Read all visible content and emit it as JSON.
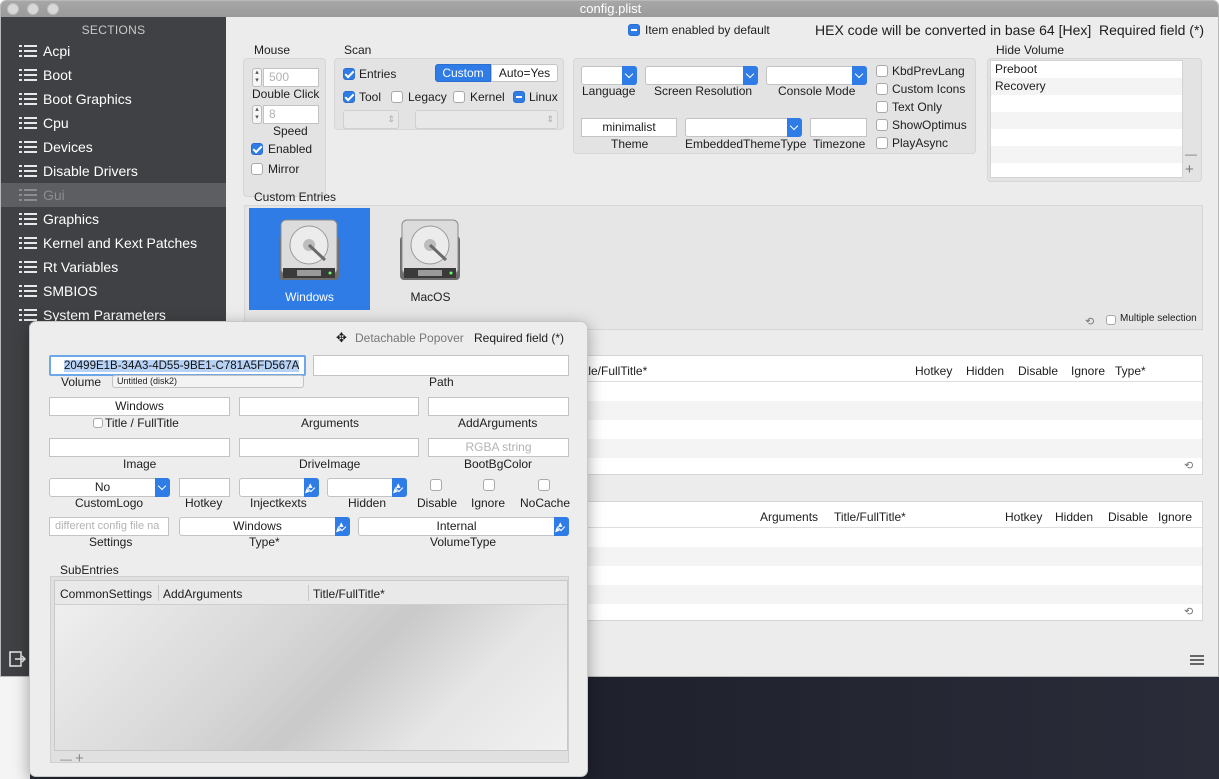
{
  "window": {
    "title": "config.plist"
  },
  "sidebar": {
    "header": "SECTIONS",
    "items": [
      {
        "label": "Acpi"
      },
      {
        "label": "Boot"
      },
      {
        "label": "Boot Graphics"
      },
      {
        "label": "Cpu"
      },
      {
        "label": "Devices"
      },
      {
        "label": "Disable Drivers"
      },
      {
        "label": "Gui",
        "selected": true
      },
      {
        "label": "Graphics"
      },
      {
        "label": "Kernel and Kext Patches"
      },
      {
        "label": "Rt Variables"
      },
      {
        "label": "SMBIOS"
      },
      {
        "label": "System Parameters"
      }
    ]
  },
  "topbar": {
    "item_enabled_label": "Item enabled by default",
    "hex_note": "HEX code will be converted in base 64 [Hex]",
    "required_note": "Required field (*)"
  },
  "mouse": {
    "title": "Mouse",
    "double_click_value": "500",
    "double_click_label": "Double Click",
    "speed_value": "8",
    "speed_label": "Speed",
    "enabled_label": "Enabled",
    "enabled": true,
    "mirror_label": "Mirror",
    "mirror": false
  },
  "scan": {
    "title": "Scan",
    "entries_label": "Entries",
    "entries": true,
    "custom_label": "Custom",
    "autoyes_label": "Auto=Yes",
    "tool_label": "Tool",
    "tool": true,
    "legacy_label": "Legacy",
    "kernel_label": "Kernel",
    "linux_label": "Linux"
  },
  "gui_fields": {
    "language_label": "Language",
    "resolution_label": "Screen Resolution",
    "console_label": "Console Mode",
    "theme_value": "minimalist",
    "theme_label": "Theme",
    "embedded_theme_label": "EmbeddedThemeType",
    "timezone_label": "Timezone",
    "checks": [
      {
        "label": "KbdPrevLang"
      },
      {
        "label": "Custom Icons"
      },
      {
        "label": "Text Only"
      },
      {
        "label": "ShowOptimus"
      },
      {
        "label": "PlayAsync"
      }
    ]
  },
  "hide_volume": {
    "title": "Hide Volume",
    "items": [
      "Preboot",
      "Recovery"
    ],
    "minus": "—",
    "plus": "+"
  },
  "custom_entries": {
    "title": "Custom Entries",
    "entries": [
      {
        "label": "Windows",
        "selected": true
      },
      {
        "label": "MacOS",
        "selected": false
      }
    ],
    "multiple_selection_label": "Multiple selection",
    "minus": "—",
    "plus": "+"
  },
  "table1": {
    "columns": [
      "tle/FullTitle*",
      "Hotkey",
      "Hidden",
      "Disable",
      "Ignore",
      "Type*"
    ]
  },
  "table2": {
    "columns": [
      "Arguments",
      "Title/FullTitle*",
      "Hotkey",
      "Hidden",
      "Disable",
      "Ignore"
    ]
  },
  "popover": {
    "detach_label": "Detachable Popover",
    "required_label": "Required field (*)",
    "uuid_value": "20499E1B-34A3-4D55-9BE1-C781A5FD567A",
    "volume_label": "Volume",
    "volume_value": "Untitled (disk2)",
    "path_label": "Path",
    "title_value": "Windows",
    "title_label": "Title / FullTitle",
    "arguments_label": "Arguments",
    "addarguments_label": "AddArguments",
    "image_label": "Image",
    "driveimage_label": "DriveImage",
    "bootbg_placeholder": "RGBA string",
    "bootbg_label": "BootBgColor",
    "customlogo_value": "No",
    "customlogo_label": "CustomLogo",
    "hotkey_label": "Hotkey",
    "injectkexts_label": "Injectkexts",
    "hidden_label": "Hidden",
    "disable_label": "Disable",
    "ignore_label": "Ignore",
    "nocache_label": "NoCache",
    "settings_placeholder": "different config file na",
    "settings_label": "Settings",
    "type_value": "Windows",
    "type_label": "Type*",
    "volumetype_value": "Internal",
    "volumetype_label": "VolumeType",
    "subentries_title": "SubEntries",
    "sub_columns": [
      "CommonSettings",
      "AddArguments",
      "Title/FullTitle*"
    ],
    "minus": "—",
    "plus": "+"
  },
  "colors": {
    "accent": "#2f7ce6",
    "sidebar": "#3f4144",
    "selection": "#5c5e62"
  }
}
